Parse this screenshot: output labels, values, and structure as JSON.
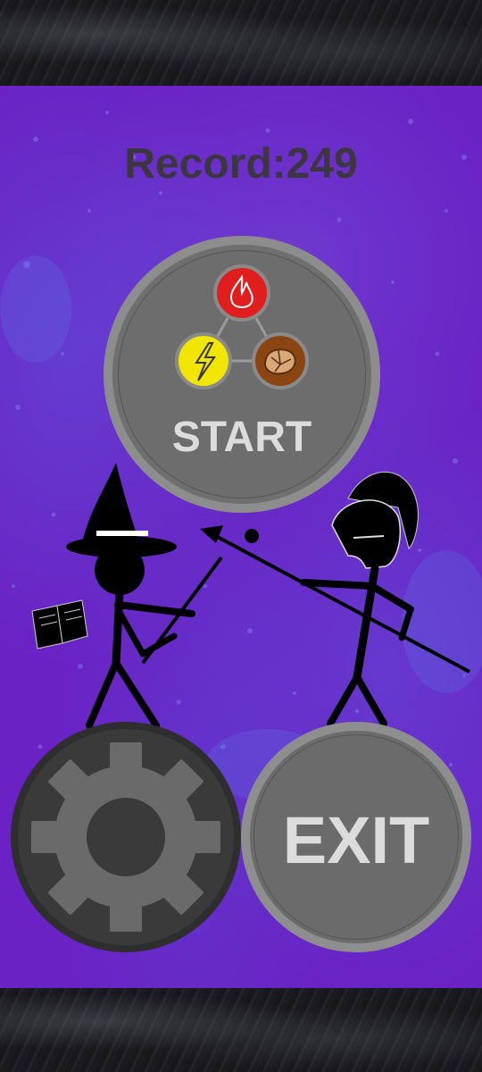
{
  "header": {
    "record_text": "Record:249"
  },
  "menu": {
    "start_label": "START",
    "exit_label": "EXIT",
    "settings_icon": "gear-icon"
  },
  "elements": {
    "fire": {
      "icon": "fire-icon",
      "color": "#e01e1e"
    },
    "lightning": {
      "icon": "lightning-icon",
      "color": "#f2e600"
    },
    "earth": {
      "icon": "rock-icon",
      "color": "#8b4513"
    }
  },
  "characters": {
    "left": "wizard-stickman",
    "right": "spartan-stickman"
  },
  "colors": {
    "background_purple": "#6a22c4",
    "button_gray": "#6f6f6f",
    "record_text": "#3c3640"
  }
}
